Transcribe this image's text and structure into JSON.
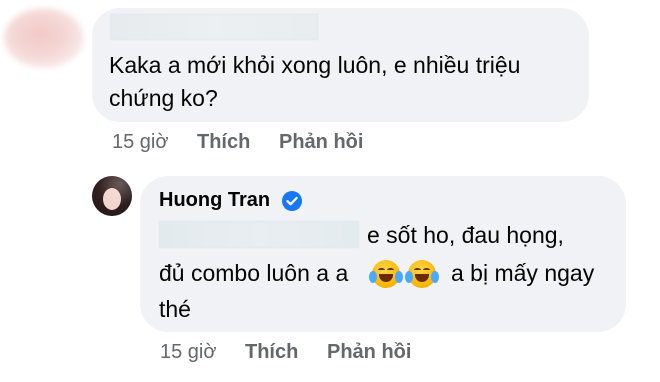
{
  "comment": {
    "text": "Kaka a mới khỏi xong luôn, e nhiều triệu chứng ko?",
    "time": "15 giờ",
    "like_label": "Thích",
    "reply_label": "Phản hồi"
  },
  "reply": {
    "author": "Huong Tran",
    "verified_icon": "verified-badge-icon",
    "line1": "e sốt ho, đau họng,",
    "line2_before": "đủ combo luôn a a",
    "emoji_icon": "face-with-tears-of-joy-icon",
    "line2_after": "a bị mấy ngay",
    "line3": "thé",
    "time": "15 giờ",
    "like_label": "Thích",
    "reply_label": "Phản hồi"
  },
  "colors": {
    "bubble": "#f0f2f5",
    "meta_text": "#65676b",
    "verified": "#1877f2"
  }
}
